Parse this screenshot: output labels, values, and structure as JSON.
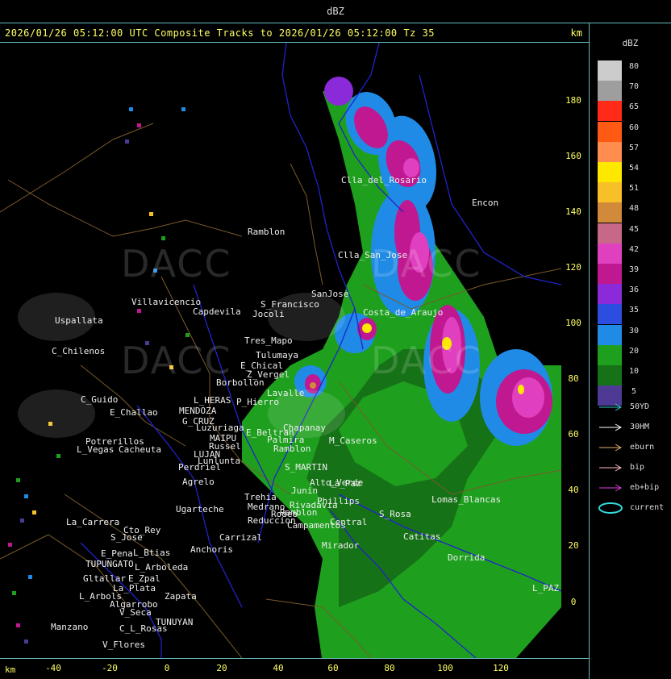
{
  "window": {
    "title": "dBZ"
  },
  "header": {
    "title": "2026/01/26 05:12:00 UTC Composite Tracks to 2026/01/26 05:12:00 Tz 35",
    "unit": "km"
  },
  "axes": {
    "y_ticks": [
      "180",
      "160",
      "140",
      "120",
      "100",
      "80",
      "60",
      "40",
      "20",
      "0"
    ],
    "x_ticks": [
      "-40",
      "-20",
      "0",
      "20",
      "40",
      "60",
      "80",
      "100",
      "120"
    ],
    "x_unit": "km"
  },
  "watermark": {
    "text": "DACC"
  },
  "places": [
    "Villavicencio",
    "Uspallata",
    "C_Chilenos",
    "Capdevila",
    "S_Francisco",
    "Jocoli",
    "Tres_Mapo",
    "Tulumaya",
    "Lavalle",
    "Ramblon",
    "Clla_del_Rosario",
    "Encon",
    "Clla_San_Jose",
    "SanJose",
    "Costa_de_Araujo",
    "C_Guido",
    "E_Challao",
    "L_HERAS",
    "MENDOZA",
    "G_CRUZ",
    "Luzuriaga",
    "MAIPU",
    "Russel",
    "LUJAN",
    "Lunlunta",
    "Perdriel",
    "Potrerillos",
    "L_Vegas",
    "Cacheuta",
    "Agrelo",
    "Ugarteche",
    "E_Chical",
    "Z_Vergel",
    "P_Hierro",
    "Borbollon",
    "E_Beltran",
    "Chapanay",
    "Palmira",
    "Ramblon",
    "S_MARTIN",
    "M_Caseros",
    "La_Paz",
    "Lomas_Blancas",
    "Catitas",
    "Dorrida",
    "Alto_Verde",
    "Rivadavia",
    "Junin",
    "Medrano",
    "Campamentos",
    "Mirador",
    "Phillips",
    "La_Carrera",
    "Cto_Rey",
    "S_Jose",
    "E_Pena",
    "TUPUNGATO",
    "L_Btias",
    "Anchoris",
    "L_Arboleda",
    "Gltallar",
    "E_Zpal",
    "L_Arbols",
    "Zapata",
    "La_Plata",
    "Algarrobo",
    "V_Seca",
    "TUNUYAN",
    "Manzano",
    "C_L_Rosas",
    "V_Flores",
    "Carrizal",
    "Trehia",
    "Rodeo",
    "Reduccion",
    "S_Rosa",
    "Central",
    "L_PAZ",
    "Ramblon"
  ],
  "legend": {
    "title": "dBZ",
    "levels": [
      {
        "label": "80",
        "color": "#cccccc"
      },
      {
        "label": "70",
        "color": "#9e9e9e"
      },
      {
        "label": "65",
        "color": "#ff2a18"
      },
      {
        "label": "60",
        "color": "#ff5a14"
      },
      {
        "label": "57",
        "color": "#ff8d4e"
      },
      {
        "label": "54",
        "color": "#ffe800"
      },
      {
        "label": "51",
        "color": "#f8c028"
      },
      {
        "label": "48",
        "color": "#d08a3a"
      },
      {
        "label": "45",
        "color": "#c86888"
      },
      {
        "label": "42",
        "color": "#e040c0"
      },
      {
        "label": "39",
        "color": "#c01890"
      },
      {
        "label": "36",
        "color": "#8a2ad8"
      },
      {
        "label": "35",
        "color": "#2b4ee0"
      },
      {
        "label": "30",
        "color": "#1f8be6"
      },
      {
        "label": "20",
        "color": "#1ea01e"
      },
      {
        "label": "10",
        "color": "#167216"
      },
      {
        "label": "5",
        "color": "#4e3a94"
      }
    ],
    "tracks": [
      {
        "label": "50YD",
        "color": "#33cccc"
      },
      {
        "label": "30HM",
        "color": "#ffffff"
      },
      {
        "label": "eburn",
        "color": "#e0b070"
      },
      {
        "label": "bip",
        "color": "#ffbcc0"
      },
      {
        "label": "eb+bip",
        "color": "#e040e0"
      },
      {
        "label": "current",
        "color": "#33dddd"
      }
    ]
  }
}
